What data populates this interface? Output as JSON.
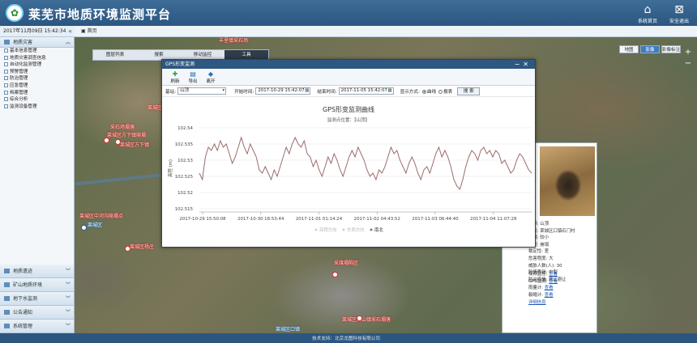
{
  "header": {
    "title": "莱芜市地质环境监测平台",
    "home_label": "系统首页",
    "logout_label": "安全退出"
  },
  "datebar": {
    "datetime": "2017年11月09日 15:42:34",
    "collapse": "«"
  },
  "tabs": {
    "home": "首页"
  },
  "sidebar": {
    "top_section": "地质灾害",
    "items": [
      "基本信息管理",
      "地质灾害调查信息",
      "自动化监测管理",
      "预警管理",
      "防治管理",
      "应急管理",
      "档案管理",
      "综合分析",
      "监测设备管理"
    ],
    "bottom_sections": [
      "地质遗迹",
      "矿山地质环境",
      "地下水监测",
      "公告通知",
      "系统管理"
    ]
  },
  "map": {
    "toolbar": [
      "图层列表",
      "搜索",
      "移动监控",
      "工具"
    ],
    "layers": [
      "地图",
      "影像",
      "影像标注"
    ],
    "labels": [
      {
        "t": "羊里镇采石场"
      },
      {
        "t": "采石场塌落"
      },
      {
        "t": "莱城区方下镇崩塌"
      },
      {
        "t": "莱城区方下镇"
      },
      {
        "t": "莱城区牛泉镇滑坡"
      },
      {
        "t": "莱城区中河沟崩塌点"
      },
      {
        "t": "莱城区"
      },
      {
        "t": "莱城区杨庄"
      },
      {
        "t": "采煤塌陷区"
      },
      {
        "t": "莱城区苗山镇采石塌落"
      },
      {
        "t": "莱城区口镇"
      }
    ],
    "zoom_in": "+",
    "zoom_out": "−"
  },
  "info_popup": {
    "lines": [
      "名称: 山顶",
      "位置: 莱城区口镇石门村",
      "规模: 较小",
      "类型: 崩塌",
      "稳定性: 差",
      "危害程度: 大",
      "威胁人数(人): 30",
      "险情等级: 中型",
      "防治措施: 搬迁避让"
    ],
    "links": [
      {
        "label": "视频监控:",
        "link": "查看"
      },
      {
        "label": "GPS监测:",
        "link": "查看"
      },
      {
        "label": "雨量计:",
        "link": "查看"
      },
      {
        "label": "裂缝计:",
        "link": "查看"
      }
    ],
    "more": "详细信息"
  },
  "dialog": {
    "title": "GPS形变监测",
    "tools": [
      "刷新",
      "导出",
      "离开"
    ],
    "form": {
      "station_label": "基站:",
      "station_value": "山顶",
      "start_label": "开始时间:",
      "start_value": "2017-10-29 15:42:07",
      "end_label": "结束时间:",
      "end_value": "2017-11-05 15:42:07",
      "mode_label": "显示方式:",
      "mode_options": [
        "曲线",
        "报表"
      ],
      "search": "搜 索"
    }
  },
  "chart_data": {
    "type": "line",
    "title": "GPS形变监测曲线",
    "subtitle": "监测点位置：【山顶】",
    "ylabel": "高程 (m)",
    "ylim": [
      102.515,
      102.54
    ],
    "yticks": [
      102.54,
      102.535,
      102.53,
      102.525,
      102.52,
      102.515
    ],
    "ytick_labels": [
      "102.54",
      "102.535",
      "102.53",
      "102.525",
      "102.52",
      "102.515"
    ],
    "xtick_labels": [
      "2017-10-29 15:50:08",
      "2017-10-30 18:53:44",
      "2017-11-01 01:14:24",
      "2017-11-02 04:43:52",
      "2017-11-03 06:44:40",
      "2017-11-04 11:07:28"
    ],
    "legend": [
      "高程方向",
      "东西方向",
      "南北"
    ],
    "series": [
      {
        "name": "南北",
        "color": "#9c6b6b",
        "values": [
          102.526,
          102.524,
          102.531,
          102.534,
          102.533,
          102.535,
          102.533,
          102.536,
          102.534,
          102.535,
          102.532,
          102.529,
          102.531,
          102.534,
          102.537,
          102.534,
          102.532,
          102.535,
          102.533,
          102.531,
          102.527,
          102.526,
          102.528,
          102.526,
          102.524,
          102.527,
          102.525,
          102.528,
          102.531,
          102.534,
          102.532,
          102.535,
          102.537,
          102.535,
          102.534,
          102.536,
          102.532,
          102.531,
          102.528,
          102.53,
          102.527,
          102.525,
          102.528,
          102.531,
          102.529,
          102.532,
          102.53,
          102.527,
          102.525,
          102.528,
          102.531,
          102.533,
          102.531,
          102.534,
          102.532,
          102.53,
          102.527,
          102.525,
          102.526,
          102.524,
          102.527,
          102.526,
          102.528,
          102.531,
          102.534,
          102.532,
          102.533,
          102.53,
          102.528,
          102.526,
          102.529,
          102.531,
          102.529,
          102.526,
          102.524,
          102.527,
          102.528,
          102.526,
          102.529,
          102.532,
          102.534,
          102.531,
          102.533,
          102.531,
          102.528,
          102.524,
          102.522,
          102.521,
          102.524,
          102.528,
          102.531,
          102.533,
          102.532,
          102.53,
          102.533,
          102.534,
          102.532,
          102.533,
          102.531,
          102.533,
          102.532,
          102.529,
          102.53,
          102.528,
          102.526,
          102.527,
          102.53,
          102.532,
          102.531,
          102.529,
          102.527,
          102.526
        ]
      }
    ]
  }
}
